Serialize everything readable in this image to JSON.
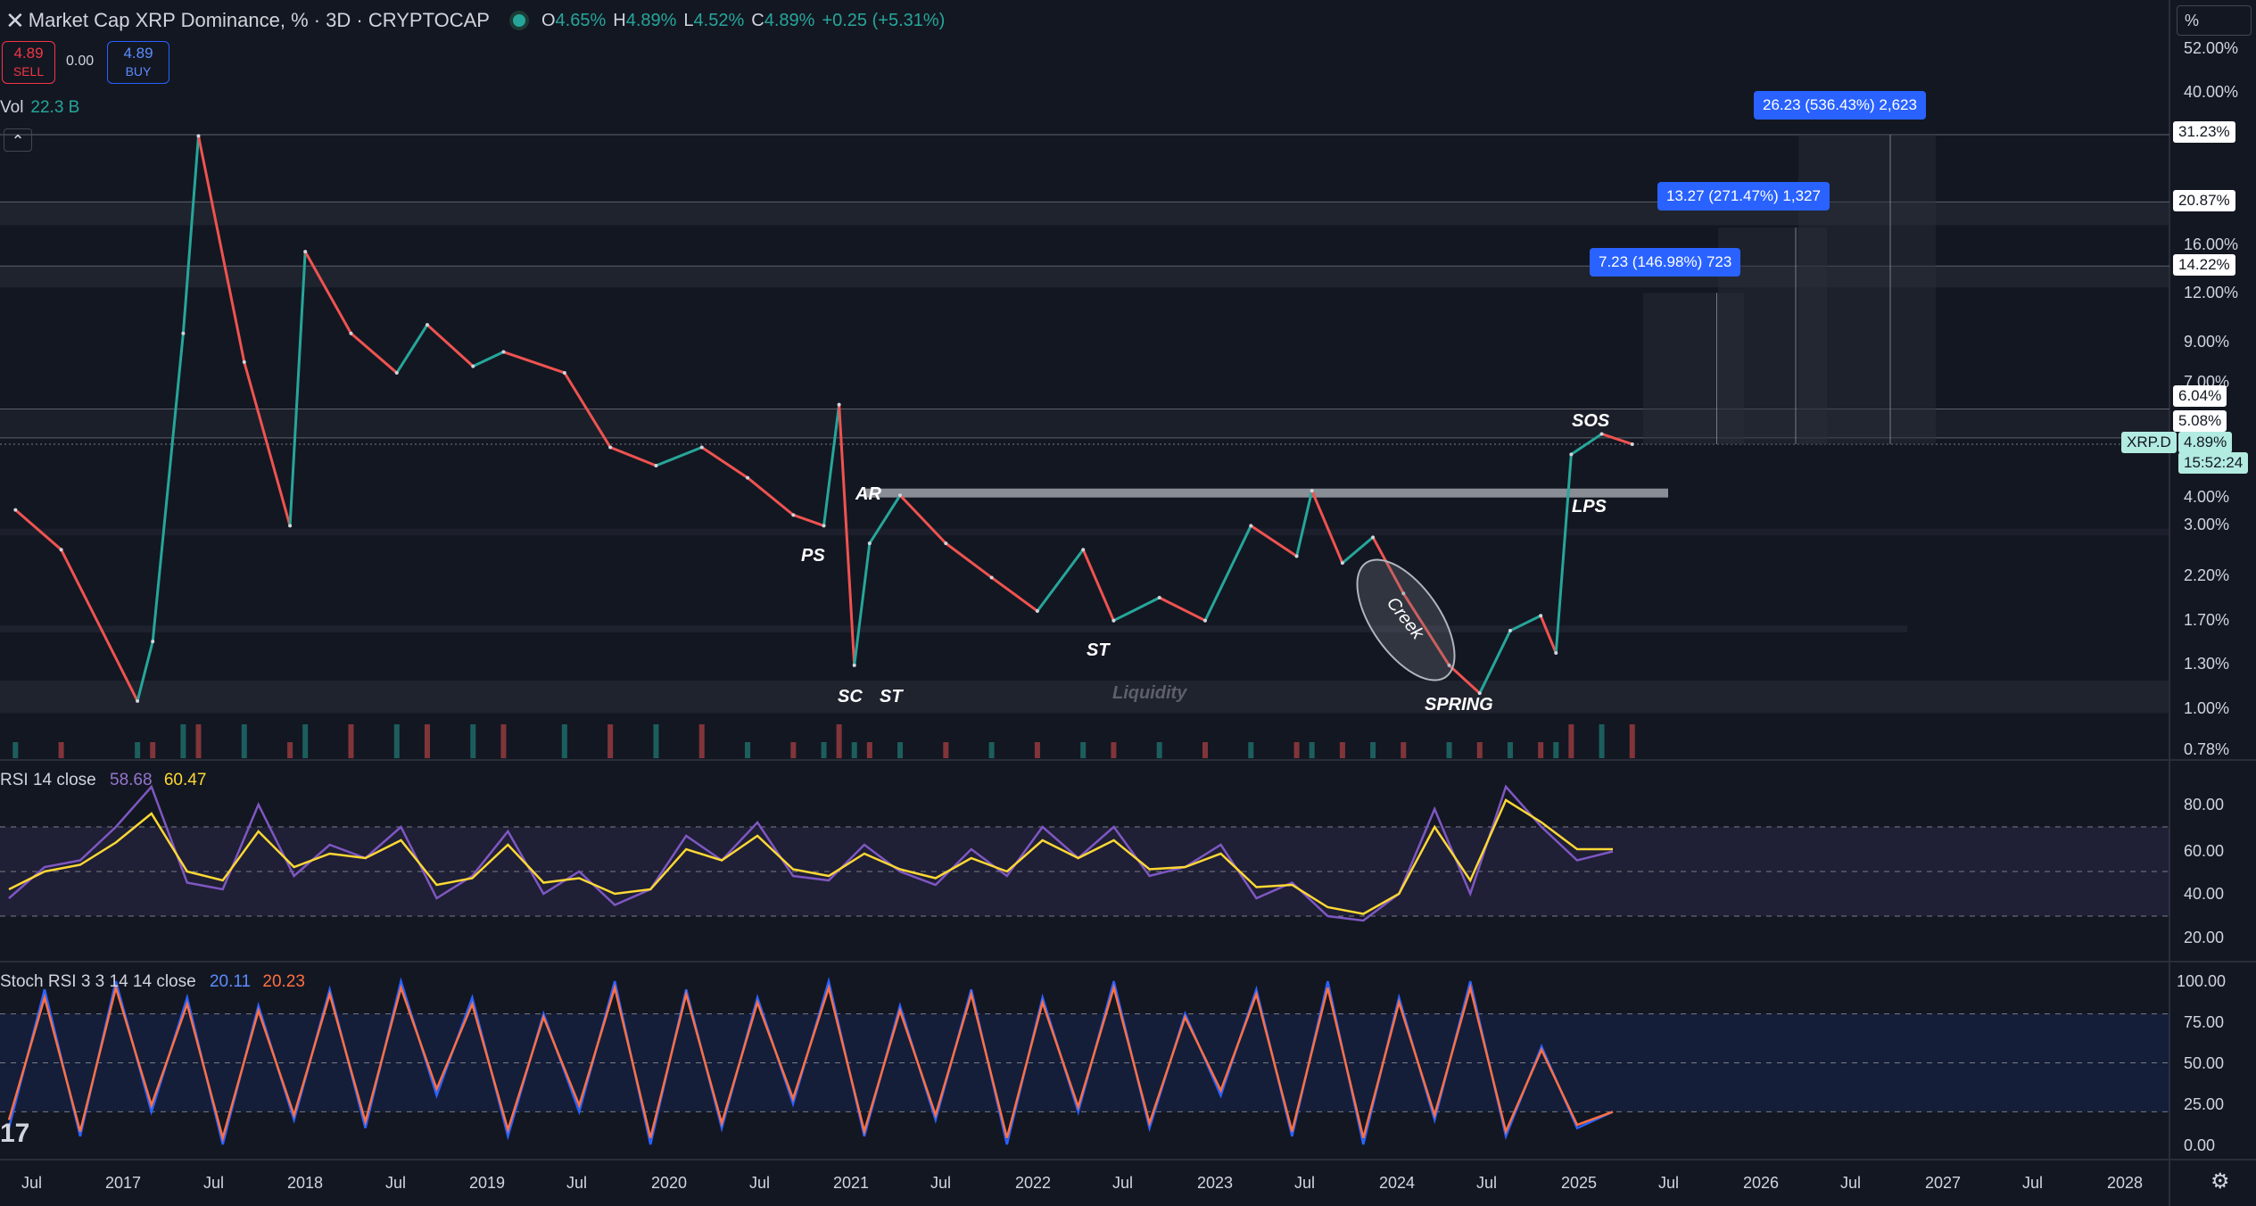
{
  "header": {
    "title": "Market Cap XRP Dominance, % · 3D · CRYPTOCAP",
    "ohlc": {
      "o": "4.65%",
      "h": "4.89%",
      "l": "4.52%",
      "c": "4.89%",
      "change": "+0.25 (+5.31%)"
    }
  },
  "trade": {
    "sell_price": "4.89",
    "sell_label": "SELL",
    "spread": "0.00",
    "buy_price": "4.89",
    "buy_label": "BUY"
  },
  "volume": {
    "label": "Vol",
    "value": "22.3 B"
  },
  "rsi": {
    "label": "RSI 14 close",
    "rsi_value": "58.68",
    "ma_value": "60.47"
  },
  "stoch": {
    "label": "Stoch RSI 3 3 14 14 close",
    "k_value": "20.11",
    "d_value": "20.23"
  },
  "scale_button": "%",
  "colors": {
    "background": "#131722",
    "up": "#26a69a",
    "down": "#ef5350",
    "rsi_line": "#7e57c2",
    "rsi_ma": "#fdd835",
    "stoch_k": "#2962ff",
    "stoch_d": "#ff7043",
    "measure": "#2962ff"
  },
  "icons": {
    "close": "close-icon",
    "collapse": "chevron-up-icon",
    "logo": "tradingview-logo-icon",
    "settings": "gear-icon"
  },
  "chart_data": [
    {
      "type": "candlestick",
      "title": "Market Cap XRP Dominance, %",
      "scale": "log",
      "y_tick_labels": [
        "52.00%",
        "40.00%",
        "31.23%",
        "20.87%",
        "16.00%",
        "14.22%",
        "12.00%",
        "9.00%",
        "7.00%",
        "6.04%",
        "5.08%",
        "4.89%",
        "4.00%",
        "3.00%",
        "2.20%",
        "1.70%",
        "1.30%",
        "1.00%",
        "0.78%"
      ],
      "x_tick_labels": [
        "Jul",
        "2017",
        "Jul",
        "2018",
        "Jul",
        "2019",
        "Jul",
        "2020",
        "Jul",
        "2021",
        "Jul",
        "2022",
        "Jul",
        "2023",
        "Jul",
        "2024",
        "Jul",
        "2025",
        "Jul",
        "2026",
        "Jul",
        "2027",
        "Jul",
        "2028"
      ],
      "series": [
        {
          "x": [
            "2016-06",
            "2016-09",
            "2017-02",
            "2017-03",
            "2017-05",
            "2017-06",
            "2017-09",
            "2017-12",
            "2018-01",
            "2018-04",
            "2018-07",
            "2018-09",
            "2018-12",
            "2019-02",
            "2019-06",
            "2019-09",
            "2019-12",
            "2020-03",
            "2020-06",
            "2020-09",
            "2020-11",
            "2020-12",
            "2021-01",
            "2021-02",
            "2021-04",
            "2021-07",
            "2021-10",
            "2022-01",
            "2022-04",
            "2022-06",
            "2022-09",
            "2022-12",
            "2023-03",
            "2023-06",
            "2023-07",
            "2023-09",
            "2023-11",
            "2024-01",
            "2024-04",
            "2024-06",
            "2024-08",
            "2024-10",
            "2024-11",
            "2024-12",
            "2025-02",
            "2025-04"
          ],
          "values": [
            3.3,
            2.6,
            1.05,
            1.5,
            9.5,
            31.0,
            8.0,
            3.0,
            15.5,
            9.5,
            7.5,
            10.0,
            7.8,
            8.5,
            7.5,
            4.8,
            4.3,
            4.8,
            4.0,
            3.2,
            3.0,
            6.2,
            1.3,
            2.7,
            3.6,
            2.7,
            2.2,
            1.8,
            2.6,
            1.7,
            1.95,
            1.7,
            3.0,
            2.5,
            3.7,
            2.4,
            2.8,
            2.0,
            1.3,
            1.1,
            1.6,
            1.75,
            1.4,
            4.6,
            5.2,
            4.89
          ]
        }
      ],
      "annotations": [
        "PS",
        "AR",
        "SC",
        "ST",
        "ST",
        "Creek",
        "SPRING",
        "LPS",
        "SOS",
        "Liquidity"
      ],
      "price_labels": [
        "31.23%",
        "20.87%",
        "14.22%",
        "6.04%",
        "5.08%",
        "XRP.D",
        "4.89%",
        "15:52:24"
      ],
      "measurements": [
        "7.23 (146.98%) 723",
        "13.27 (271.47%) 1,327",
        "26.23 (536.43%) 2,623"
      ],
      "zone_levels": [
        31.23,
        20.87,
        14.22,
        6.04,
        5.08,
        3.65,
        2.95,
        1.65,
        1.05
      ]
    },
    {
      "type": "line",
      "title": "RSI 14 close",
      "ylim": [
        15,
        90
      ],
      "y_tick_labels": [
        "80.00",
        "60.00",
        "40.00",
        "20.00"
      ],
      "series": [
        {
          "values": [
            38,
            52,
            55,
            70,
            88,
            45,
            42,
            80,
            48,
            62,
            56,
            70,
            38,
            48,
            68,
            40,
            50,
            35,
            42,
            66,
            55,
            72,
            48,
            46,
            62,
            50,
            44,
            60,
            48,
            70,
            56,
            70,
            48,
            52,
            62,
            38,
            45,
            30,
            28,
            40,
            78,
            40,
            88,
            70,
            55,
            59
          ]
        },
        {
          "values": [
            42,
            50,
            53,
            63,
            76,
            50,
            46,
            68,
            52,
            58,
            56,
            64,
            44,
            47,
            62,
            45,
            47,
            40,
            42,
            60,
            55,
            66,
            51,
            48,
            58,
            51,
            47,
            56,
            50,
            64,
            56,
            64,
            51,
            52,
            58,
            43,
            44,
            34,
            31,
            40,
            70,
            46,
            82,
            72,
            60,
            60
          ]
        }
      ]
    },
    {
      "type": "line",
      "title": "Stoch RSI 3 3 14 14 close",
      "ylim": [
        0,
        100
      ],
      "y_tick_labels": [
        "100.00",
        "75.00",
        "50.00",
        "25.00",
        "0.00"
      ],
      "series": [
        {
          "values": [
            10,
            95,
            5,
            100,
            20,
            90,
            0,
            85,
            15,
            95,
            10,
            100,
            30,
            90,
            5,
            80,
            20,
            100,
            0,
            95,
            10,
            90,
            25,
            100,
            5,
            85,
            15,
            95,
            0,
            90,
            20,
            100,
            10,
            80,
            30,
            95,
            5,
            100,
            0,
            90,
            15,
            100,
            5,
            60,
            10,
            20
          ]
        },
        {
          "values": [
            15,
            90,
            8,
            96,
            24,
            86,
            4,
            82,
            18,
            92,
            14,
            96,
            34,
            86,
            9,
            78,
            24,
            96,
            4,
            92,
            13,
            87,
            28,
            96,
            8,
            82,
            18,
            92,
            4,
            87,
            23,
            96,
            13,
            78,
            33,
            92,
            8,
            96,
            4,
            87,
            18,
            96,
            8,
            58,
            12,
            20
          ]
        }
      ]
    }
  ]
}
